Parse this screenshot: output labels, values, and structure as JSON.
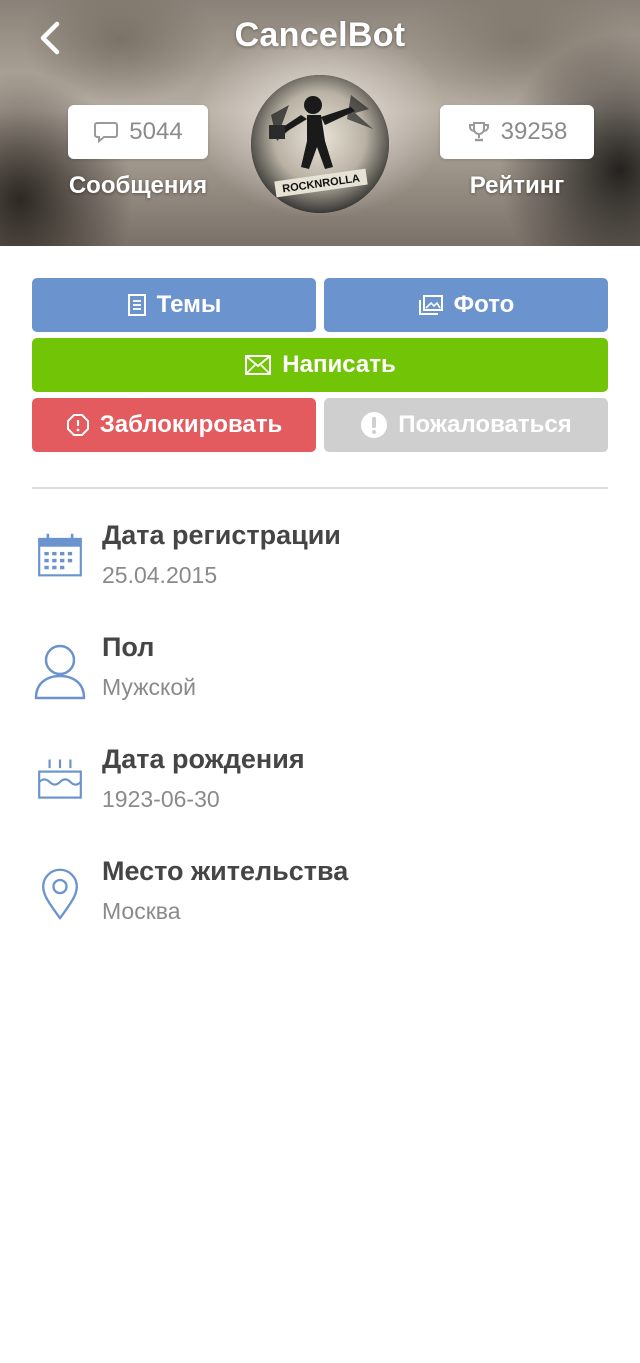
{
  "header": {
    "title": "CancelBot",
    "messages_count": "5044",
    "messages_label": "Сообщения",
    "rating_value": "39258",
    "rating_label": "Рейтинг",
    "avatar_text": "ROCKNROLLA"
  },
  "actions": {
    "topics_label": "Темы",
    "photo_label": "Фото",
    "write_label": "Написать",
    "block_label": "Заблокировать",
    "report_label": "Пожаловаться"
  },
  "info": [
    {
      "icon": "calendar-icon",
      "label": "Дата регистрации",
      "value": "25.04.2015"
    },
    {
      "icon": "user-icon",
      "label": "Пол",
      "value": "Мужской"
    },
    {
      "icon": "cake-icon",
      "label": "Дата рождения",
      "value": "1923-06-30"
    },
    {
      "icon": "location-pin-icon",
      "label": "Место жительства",
      "value": "Москва"
    }
  ],
  "colors": {
    "blue_button": "#6b93cd",
    "green_button": "#71c406",
    "red_button": "#e35b5f",
    "grey_button": "#cfcfcf",
    "icon_blue": "#6b93cd"
  }
}
